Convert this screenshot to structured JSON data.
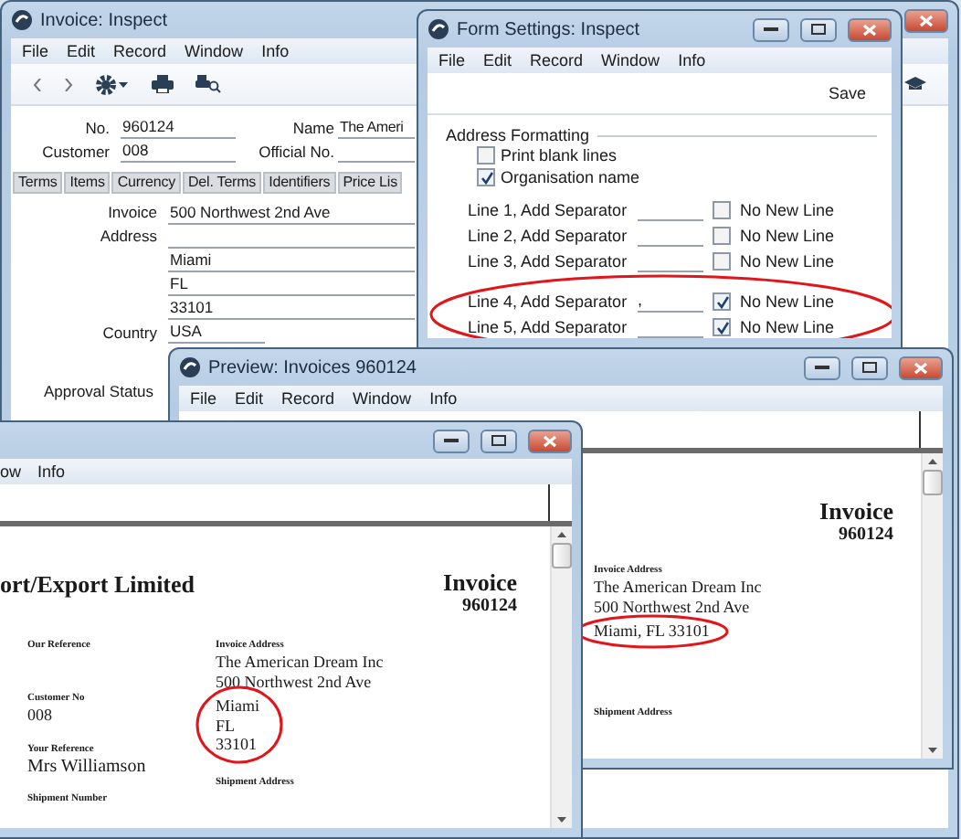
{
  "invoice_window": {
    "title": "Invoice: Inspect",
    "menu": [
      "File",
      "Edit",
      "Record",
      "Window",
      "Info"
    ],
    "header_fields": [
      {
        "label": "No.",
        "value": "960124"
      },
      {
        "label": "Customer",
        "value": "008"
      }
    ],
    "side_fields": [
      {
        "label": "Name",
        "value": "The Ameri"
      },
      {
        "label": "Official No."
      }
    ],
    "tabs": [
      "Terms",
      "Items",
      "Currency",
      "Del. Terms",
      "Identifiers",
      "Price Lis"
    ],
    "address_label": "Invoice Address",
    "street_lines": [
      "500 Northwest 2nd Ave"
    ],
    "city_lines": [
      "Miami",
      "FL",
      "33101"
    ],
    "country": {
      "label": "Country",
      "value": "USA"
    },
    "approval_label": "Approval Status"
  },
  "form_settings_window": {
    "title": "Form Settings: Inspect",
    "menu": [
      "File",
      "Edit",
      "Record",
      "Window",
      "Info"
    ],
    "save": "Save",
    "section": "Address Formatting",
    "options": [
      {
        "label": "Print blank lines",
        "checked": false
      },
      {
        "label": "Organisation name",
        "checked": true
      }
    ],
    "lines": [
      {
        "label": "Line 1, Add Separator",
        "no_new_line_label": "No New Line",
        "checked": false
      },
      {
        "label": "Line 2, Add Separator",
        "no_new_line_label": "No New Line",
        "checked": false
      },
      {
        "label": "Line 3, Add Separator",
        "no_new_line_label": "No New Line",
        "checked": false
      }
    ],
    "highlighted_lines": [
      {
        "label": "Line 4, Add Separator",
        "separator": ",",
        "no_new_line_label": "No New Line",
        "checked": true
      },
      {
        "label": "Line 5, Add Separator",
        "no_new_line_label": "No New Line",
        "checked": true
      }
    ]
  },
  "preview_window": {
    "title": "Preview: Invoices 960124",
    "menu": [
      "File",
      "Edit",
      "Record",
      "Window",
      "Info"
    ],
    "document": {
      "title": "Invoice",
      "number": "960124",
      "address_heading": "Invoice Address",
      "address_lines": [
        "The American Dream Inc",
        "500 Northwest 2nd Ave"
      ],
      "highlighted_lines": [
        "Miami, FL 33101"
      ],
      "shipment_heading": "Shipment Address"
    }
  },
  "second_preview_window": {
    "menu": [
      "ow",
      "Info"
    ],
    "document": {
      "company": "ort/Export Limited",
      "title": "Invoice",
      "number": "960124",
      "left_fields": [
        {
          "label": "Our Reference"
        },
        {
          "label": "Customer No",
          "value": "008"
        },
        {
          "label": "Your Reference",
          "value": "Mrs Williamson"
        },
        {
          "label": "Shipment Number"
        }
      ],
      "address_heading": "Invoice Address",
      "address_lines": [
        "The American Dream Inc",
        "500 Northwest 2nd Ave"
      ],
      "highlighted_lines": [
        "Miami",
        "FL",
        "33101"
      ],
      "shipment_heading": "Shipment Address"
    }
  }
}
